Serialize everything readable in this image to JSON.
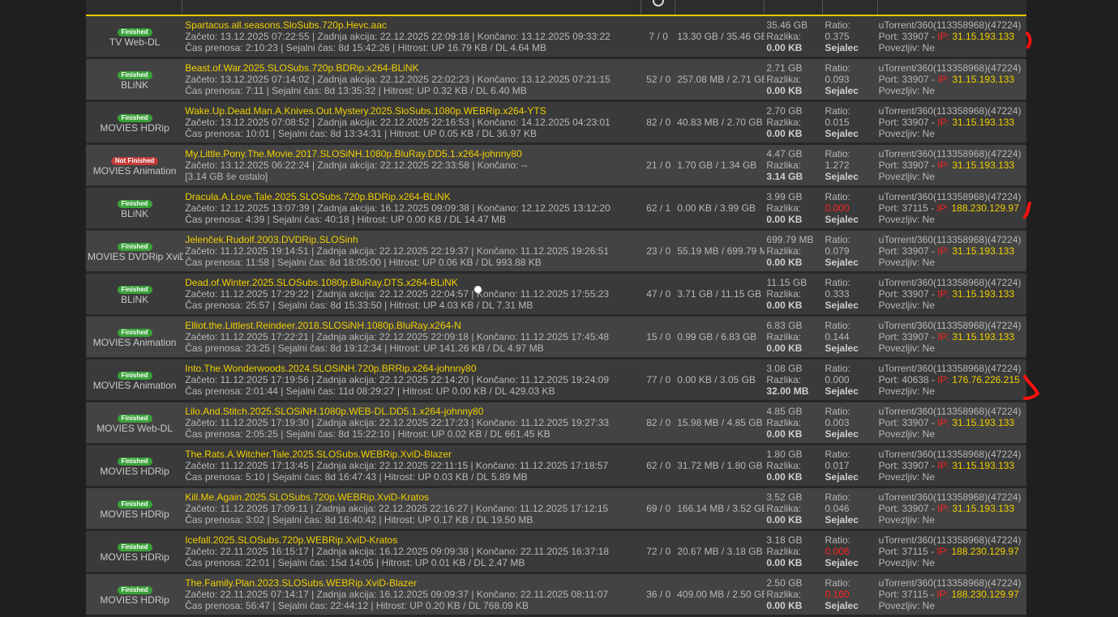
{
  "colors": {
    "accent": "#e8c800",
    "name": "#f0d000",
    "red": "#ff2020",
    "finished": "#3aa23a",
    "not_finished": "#c33a3a"
  },
  "header": {
    "icon": "circle-icon"
  },
  "rows": [
    {
      "status": "Finished",
      "category": "TV Web-DL",
      "status_type": "fin",
      "name": "Spartacus.all.seasons.SloSubs.720p.Hevc.aac",
      "line2": "Začeto: 13.12.2025 07:22:55 | Zadnja akcija: 22.12.2025 22:09:18 | Končano: 13.12.2025 09:33:22",
      "line3": "Čas prenosa: 2:10:23 | Sejalni čas: 8d 15:42:26 | Hitrost: UP 16.79 KB / DL 4.64 MB",
      "peers": "7 / 0",
      "transfer": "13.30 GB / 35.46 GB",
      "size": "35.46 GB",
      "diff_label": "Razlika:",
      "diff": "0.00 KB",
      "ratio_label": "Ratio:",
      "ratio": "0.375",
      "ratio_red": false,
      "role": "Sejalec",
      "client": "uTorrent/360(113358968)(47224)",
      "port_text": "Port: 33907 - ",
      "ip_label": "IP: ",
      "ip": "31.15.193.133",
      "connectable": "Povezljiv: Ne"
    },
    {
      "status": "Finished",
      "category": "BLiNK",
      "status_type": "fin",
      "name": "Beast.of.War.2025.SLOSubs.720p.BDRip.x264-BLiNK",
      "line2": "Začeto: 13.12.2025 07:14:02 | Zadnja akcija: 22.12.2025 22:02:23 | Končano: 13.12.2025 07:21:15",
      "line3": "Čas prenosa: 7:11 | Sejalni čas: 8d 13:35:32 | Hitrost: UP 0.32 KB / DL 6.40 MB",
      "peers": "52 / 0",
      "transfer": "257.08 MB / 2.71 GB",
      "size": "2.71 GB",
      "diff_label": "Razlika:",
      "diff": "0.00 KB",
      "ratio_label": "Ratio:",
      "ratio": "0.093",
      "ratio_red": false,
      "role": "Sejalec",
      "client": "uTorrent/360(113358968)(47224)",
      "port_text": "Port: 33907 - ",
      "ip_label": "IP: ",
      "ip": "31.15.193.133",
      "connectable": "Povezljiv: Ne"
    },
    {
      "status": "Finished",
      "category": "MOVIES HDRip",
      "status_type": "fin",
      "name": "Wake.Up.Dead.Man.A.Knives.Out.Mystery.2025.SloSubs.1080p.WEBRip.x264-YTS",
      "line2": "Začeto: 13.12.2025 07:08:52 | Zadnja akcija: 22.12.2025 22:16:53 | Končano: 14.12.2025 04:23:01",
      "line3": "Čas prenosa: 10:01 | Sejalni čas: 8d 13:34:31 | Hitrost: UP 0.05 KB / DL 36.97 KB",
      "peers": "82 / 0",
      "transfer": "40.83 MB / 2.70 GB",
      "size": "2.70 GB",
      "diff_label": "Razlika:",
      "diff": "0.00 KB",
      "ratio_label": "Ratio:",
      "ratio": "0.015",
      "ratio_red": false,
      "role": "Sejalec",
      "client": "uTorrent/360(113358968)(47224)",
      "port_text": "Port: 33907 - ",
      "ip_label": "IP: ",
      "ip": "31.15.193.133",
      "connectable": "Povezljiv: Ne"
    },
    {
      "status": "Not Finished",
      "category": "MOVIES Animation",
      "status_type": "notfin",
      "name": "My.Little.Pony.The.Movie.2017.SLOSiNH.1080p.BluRay.DD5.1.x264-johnny80",
      "line2": "Začeto: 13.12.2025 06:22:24 | Zadnja akcija: 22.12.2025 22:33:58 | Končano: --",
      "line3": "[3.14 GB še ostalo]",
      "peers": "21 / 0",
      "transfer": "1.70 GB / 1.34 GB",
      "size": "4.47 GB",
      "diff_label": "Razlika:",
      "diff": "3.14 GB",
      "ratio_label": "Ratio:",
      "ratio": "1.272",
      "ratio_red": false,
      "role": "Sejalec",
      "client": "uTorrent/360(113358968)(47224)",
      "port_text": "Port: 33907 - ",
      "ip_label": "IP: ",
      "ip": "31.15.193.133",
      "connectable": "Povezljiv: Ne"
    },
    {
      "status": "Finished",
      "category": "BLiNK",
      "status_type": "fin",
      "name": "Dracula.A.Love.Tale.2025.SLOSubs.720p.BDRip.x264-BLiNK",
      "line2": "Začeto: 12.12.2025 13:07:39 | Zadnja akcija: 16.12.2025 09:09:38 | Končano: 12.12.2025 13:12:20",
      "line3": "Čas prenosa: 4:39 | Sejalni čas: 40:18 | Hitrost: UP 0.00 KB / DL 14.47 MB",
      "peers": "62 / 1",
      "transfer": "0.00 KB / 3.99 GB",
      "size": "3.99 GB",
      "diff_label": "Razlika:",
      "diff": "0.00 KB",
      "ratio_label": "Ratio:",
      "ratio": "0.000",
      "ratio_red": true,
      "role": "Sejalec",
      "client": "uTorrent/360(113358968)(47224)",
      "port_text": "Port: 37115 - ",
      "ip_label": "IP: ",
      "ip": "188.230.129.97",
      "connectable": "Povezljiv: Ne"
    },
    {
      "status": "Finished",
      "category": "MOVIES DVDRip XviD",
      "status_type": "fin",
      "name": "Jelenček.Rudolf.2003.DVDRip.SLOSinh",
      "line2": "Začeto: 11.12.2025 19:14:51 | Zadnja akcija: 22.12.2025 22:19:37 | Končano: 11.12.2025 19:26:51",
      "line3": "Čas prenosa: 11:58 | Sejalni čas: 8d 18:05:00 | Hitrost: UP 0.06 KB / DL 993.88 KB",
      "peers": "23 / 0",
      "transfer": "55.19 MB / 699.79 MB",
      "size": "699.79 MB",
      "diff_label": "Razlika:",
      "diff": "0.00 KB",
      "ratio_label": "Ratio:",
      "ratio": "0.079",
      "ratio_red": false,
      "role": "Sejalec",
      "client": "uTorrent/360(113358968)(47224)",
      "port_text": "Port: 33907 - ",
      "ip_label": "IP: ",
      "ip": "31.15.193.133",
      "connectable": "Povezljiv: Ne"
    },
    {
      "status": "Finished",
      "category": "BLiNK",
      "status_type": "fin",
      "name": "Dead.of.Winter.2025.SLOSubs.1080p.BluRay.DTS.x264-BLiNK",
      "line2": "Začeto: 11.12.2025 17:29:22 | Zadnja akcija: 22.12.2025 22:04:57 | Končano: 11.12.2025 17:55:23",
      "line3": "Čas prenosa: 25:57 | Sejalni čas: 8d 15:33:50 | Hitrost: UP 4.03 KB / DL 7.31 MB",
      "peers": "47 / 0",
      "transfer": "3.71 GB / 11.15 GB",
      "size": "11.15 GB",
      "diff_label": "Razlika:",
      "diff": "0.00 KB",
      "ratio_label": "Ratio:",
      "ratio": "0.333",
      "ratio_red": false,
      "role": "Sejalec",
      "client": "uTorrent/360(113358968)(47224)",
      "port_text": "Port: 33907 - ",
      "ip_label": "IP: ",
      "ip": "31.15.193.133",
      "connectable": "Povezljiv: Ne"
    },
    {
      "status": "Finished",
      "category": "MOVIES Animation",
      "status_type": "fin",
      "name": "Elliot.the.Littlest.Reindeer.2018.SLOSiNH.1080p.BluRay.x264-N",
      "line2": "Začeto: 11.12.2025 17:22:21 | Zadnja akcija: 22.12.2025 22:09:18 | Končano: 11.12.2025 17:45:48",
      "line3": "Čas prenosa: 23:25 | Sejalni čas: 8d 19:12:34 | Hitrost: UP 141.26 KB / DL 4.97 MB",
      "peers": "15 / 0",
      "transfer": "0.99 GB / 6.83 GB",
      "size": "6.83 GB",
      "diff_label": "Razlika:",
      "diff": "0.00 KB",
      "ratio_label": "Ratio:",
      "ratio": "0.144",
      "ratio_red": false,
      "role": "Sejalec",
      "client": "uTorrent/360(113358968)(47224)",
      "port_text": "Port: 33907 - ",
      "ip_label": "IP: ",
      "ip": "31.15.193.133",
      "connectable": "Povezljiv: Ne"
    },
    {
      "status": "Finished",
      "category": "MOVIES Animation",
      "status_type": "fin",
      "name": "Into.The.Wonderwoods.2024.SLOSiNH.720p.BRRip.x264-johnny80",
      "line2": "Začeto: 11.12.2025 17:19:56 | Zadnja akcija: 22.12.2025 22:14:20 | Končano: 11.12.2025 19:24:09",
      "line3": "Čas prenosa: 2:01:44 | Sejalni čas: 11d 08:29:27 | Hitrost: UP 0.00 KB / DL 429.03 KB",
      "peers": "77 / 0",
      "transfer": "0.00 KB / 3.05 GB",
      "size": "3.08 GB",
      "diff_label": "Razlika:",
      "diff": "32.00 MB",
      "ratio_label": "Ratio:",
      "ratio": "0.000",
      "ratio_red": false,
      "role": "Sejalec",
      "client": "uTorrent/360(113358968)(47224)",
      "port_text": "Port: 40638 - ",
      "ip_label": "IP: ",
      "ip": "176.76.226.215",
      "connectable": "Povezljiv: Ne"
    },
    {
      "status": "Finished",
      "category": "MOVIES Web-DL",
      "status_type": "fin",
      "name": "Lilo.And.Stitch.2025.SLOSiNH.1080p.WEB-DL.DD5.1.x264-johnny80",
      "line2": "Začeto: 11.12.2025 17:19:30 | Zadnja akcija: 22.12.2025 22:17:23 | Končano: 11.12.2025 19:27:33",
      "line3": "Čas prenosa: 2:05:25 | Sejalni čas: 8d 15:22:10 | Hitrost: UP 0.02 KB / DL 661.45 KB",
      "peers": "82 / 0",
      "transfer": "15.98 MB / 4.85 GB",
      "size": "4.85 GB",
      "diff_label": "Razlika:",
      "diff": "0.00 KB",
      "ratio_label": "Ratio:",
      "ratio": "0.003",
      "ratio_red": false,
      "role": "Sejalec",
      "client": "uTorrent/360(113358968)(47224)",
      "port_text": "Port: 33907 - ",
      "ip_label": "IP: ",
      "ip": "31.15.193.133",
      "connectable": "Povezljiv: Ne"
    },
    {
      "status": "Finished",
      "category": "MOVIES HDRip",
      "status_type": "fin",
      "name": "The.Rats.A.Witcher.Tale.2025.SLOSubs.WEBRip.XviD-Blazer",
      "line2": "Začeto: 11.12.2025 17:13:45 | Zadnja akcija: 22.12.2025 22:11:15 | Končano: 11.12.2025 17:18:57",
      "line3": "Čas prenosa: 5:10 | Sejalni čas: 8d 16:47:43 | Hitrost: UP 0.03 KB / DL 5.89 MB",
      "peers": "62 / 0",
      "transfer": "31.72 MB / 1.80 GB",
      "size": "1.80 GB",
      "diff_label": "Razlika:",
      "diff": "0.00 KB",
      "ratio_label": "Ratio:",
      "ratio": "0.017",
      "ratio_red": false,
      "role": "Sejalec",
      "client": "uTorrent/360(113358968)(47224)",
      "port_text": "Port: 33907 - ",
      "ip_label": "IP: ",
      "ip": "31.15.193.133",
      "connectable": "Povezljiv: Ne"
    },
    {
      "status": "Finished",
      "category": "MOVIES HDRip",
      "status_type": "fin",
      "name": "Kill.Me.Again.2025.SLOSubs.720p.WEBRip.XviD-Kratos",
      "line2": "Začeto: 11.12.2025 17:09:11 | Zadnja akcija: 22.12.2025 22:16:27 | Končano: 11.12.2025 17:12:15",
      "line3": "Čas prenosa: 3:02 | Sejalni čas: 8d 16:40:42 | Hitrost: UP 0.17 KB / DL 19.50 MB",
      "peers": "69 / 0",
      "transfer": "166.14 MB / 3.52 GB",
      "size": "3.52 GB",
      "diff_label": "Razlika:",
      "diff": "0.00 KB",
      "ratio_label": "Ratio:",
      "ratio": "0.046",
      "ratio_red": false,
      "role": "Sejalec",
      "client": "uTorrent/360(113358968)(47224)",
      "port_text": "Port: 33907 - ",
      "ip_label": "IP: ",
      "ip": "31.15.193.133",
      "connectable": "Povezljiv: Ne"
    },
    {
      "status": "Finished",
      "category": "MOVIES HDRip",
      "status_type": "fin",
      "name": "Icefall.2025.SLOSubs.720p.WEBRip.XviD-Kratos",
      "line2": "Začeto: 22.11.2025 16:15:17 | Zadnja akcija: 16.12.2025 09:09:38 | Končano: 22.11.2025 16:37:18",
      "line3": "Čas prenosa: 22:01 | Sejalni čas: 15d 14:05 | Hitrost: UP 0.01 KB / DL 2.47 MB",
      "peers": "72 / 0",
      "transfer": "20.67 MB / 3.18 GB",
      "size": "3.18 GB",
      "diff_label": "Razlika:",
      "diff": "0.00 KB",
      "ratio_label": "Ratio:",
      "ratio": "0.006",
      "ratio_red": true,
      "role": "Sejalec",
      "client": "uTorrent/360(113358968)(47224)",
      "port_text": "Port: 37115 - ",
      "ip_label": "IP: ",
      "ip": "188.230.129.97",
      "connectable": "Povezljiv: Ne"
    },
    {
      "status": "Finished",
      "category": "MOVIES HDRip",
      "status_type": "fin",
      "name": "The.Family.Plan.2023.SLOSubs.WEBRip.XviD-Blazer",
      "line2": "Začeto: 22.11.2025 07:14:17 | Zadnja akcija: 16.12.2025 09:09:37 | Končano: 22.11.2025 08:11:07",
      "line3": "Čas prenosa: 56:47 | Sejalni čas: 22:44:12 | Hitrost: UP 0.20 KB / DL 768.09 KB",
      "peers": "36 / 0",
      "transfer": "409.00 MB / 2.50 GB",
      "size": "2.50 GB",
      "diff_label": "Razlika:",
      "diff": "0.00 KB",
      "ratio_label": "Ratio:",
      "ratio": "0.160",
      "ratio_red": true,
      "role": "Sejalec",
      "client": "uTorrent/360(113358968)(47224)",
      "port_text": "Port: 37115 - ",
      "ip_label": "IP: ",
      "ip": "188.230.129.97",
      "connectable": "Povezljiv: Ne"
    }
  ]
}
